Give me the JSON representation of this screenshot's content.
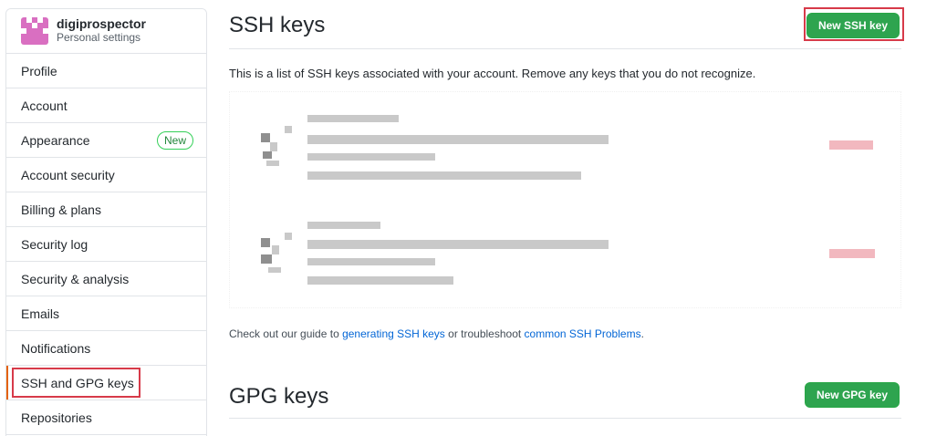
{
  "sidebar": {
    "username": "digiprospector",
    "subtitle": "Personal settings",
    "items": [
      {
        "label": "Profile"
      },
      {
        "label": "Account"
      },
      {
        "label": "Appearance",
        "badge": "New"
      },
      {
        "label": "Account security"
      },
      {
        "label": "Billing & plans"
      },
      {
        "label": "Security log"
      },
      {
        "label": "Security & analysis"
      },
      {
        "label": "Emails"
      },
      {
        "label": "Notifications"
      },
      {
        "label": "SSH and GPG keys",
        "selected": true
      },
      {
        "label": "Repositories"
      }
    ]
  },
  "ssh": {
    "title": "SSH keys",
    "new_button": "New SSH key",
    "description": "This is a list of SSH keys associated with your account. Remove any keys that you do not recognize.",
    "guide_prefix": "Check out our guide to ",
    "guide_link1": "generating SSH keys",
    "guide_middle": " or troubleshoot ",
    "guide_link2": "common SSH Problems",
    "guide_suffix": "."
  },
  "gpg": {
    "title": "GPG keys",
    "new_button": "New GPG key"
  },
  "colors": {
    "accent_green": "#2ea44f",
    "highlight_red": "#d73a49",
    "link_blue": "#0366d6",
    "selected_marker": "#e36209"
  }
}
